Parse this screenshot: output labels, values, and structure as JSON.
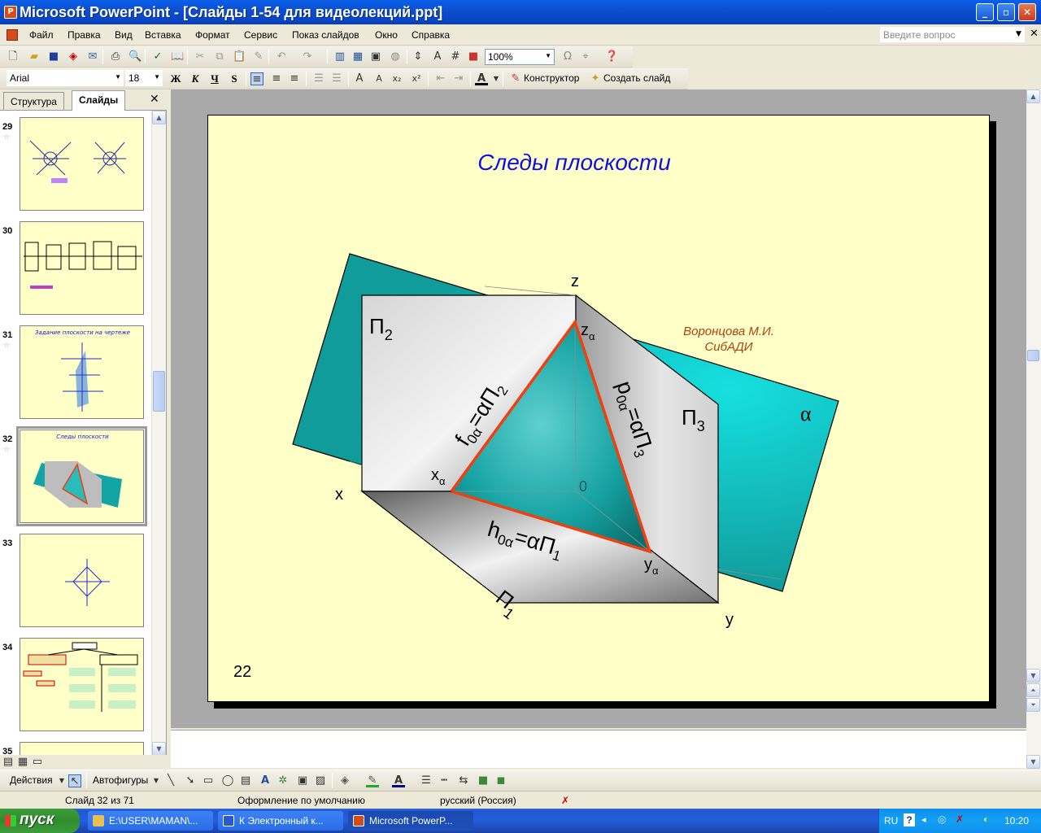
{
  "window": {
    "title": "Microsoft PowerPoint - [Слайды 1-54 для видеолекций.ppt]",
    "buttons": {
      "minimize": "_",
      "maximize": "▫",
      "close": "✕"
    }
  },
  "menu": {
    "items": [
      "Файл",
      "Правка",
      "Вид",
      "Вставка",
      "Формат",
      "Сервис",
      "Показ слайдов",
      "Окно",
      "Справка"
    ],
    "help_placeholder": "Введите вопрос"
  },
  "toolbar": {
    "zoom": "100%",
    "font": "Arial",
    "font_size": "18",
    "bold": "Ж",
    "italic": "К",
    "underline": "Ч",
    "shadow": "S",
    "designer": "Конструктор",
    "new_slide": "Создать слайд"
  },
  "left_pane": {
    "tabs": [
      "Структура",
      "Слайды"
    ],
    "active_tab": "Слайды",
    "thumbnails": [
      {
        "num": "29",
        "title": ""
      },
      {
        "num": "30",
        "title": ""
      },
      {
        "num": "31",
        "title": "Задание плоскости на чертеже"
      },
      {
        "num": "32",
        "title": "Следы плоскости",
        "selected": true
      },
      {
        "num": "33",
        "title": ""
      },
      {
        "num": "34",
        "title": ""
      },
      {
        "num": "35",
        "title": ""
      }
    ]
  },
  "slide": {
    "title": "Следы плоскости",
    "author_line1": "Воронцова М.И.",
    "author_line2": "СибАДИ",
    "number": "22",
    "labels": {
      "z": "z",
      "x": "x",
      "y": "y",
      "origin": "0",
      "alpha": "α",
      "pi2": "Π",
      "pi2_sub": "2",
      "pi3": "Π",
      "pi3_sub": "3",
      "pi1": "Π",
      "pi1_sub": "1",
      "z_alpha": "z",
      "x_alpha": "x",
      "y_alpha": "y",
      "alpha_sub": "α",
      "f_trace": "f",
      "f_trace_rest": "=αΠ",
      "p_trace": "p",
      "h_trace": "h",
      "trace_sub": "0α"
    }
  },
  "drawing_toolbar": {
    "actions": "Действия",
    "autoshapes": "Автофигуры"
  },
  "status": {
    "slide": "Слайд 32 из 71",
    "design": "Оформление по умолчанию",
    "language": "русский (Россия)"
  },
  "taskbar": {
    "start": "пуск",
    "tasks": [
      "E:\\USER\\MAMAN\\...",
      "К Электронный к...",
      "Microsoft PowerP..."
    ],
    "lang": "RU",
    "clock": "10:20"
  },
  "colors": {
    "slide_bg": "#ffffc8",
    "plane": "#13a5a5",
    "trace": "#f04010",
    "title": "#1010e0"
  }
}
